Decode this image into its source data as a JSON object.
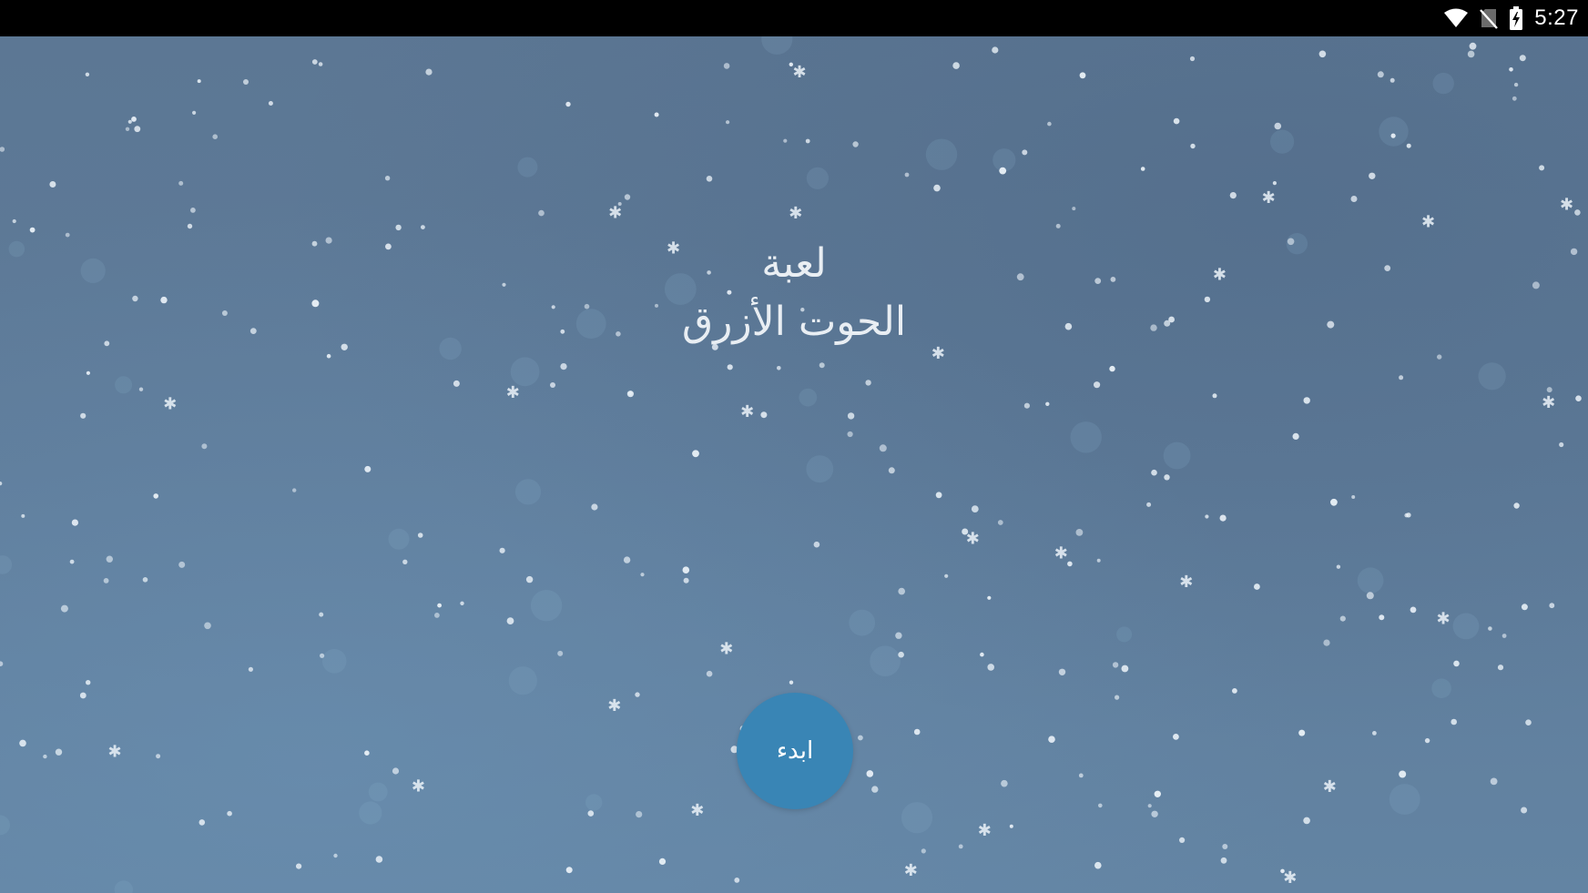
{
  "status_bar": {
    "time": "5:27",
    "icons": [
      "wifi-icon",
      "no-sim-icon",
      "battery-charging-icon"
    ]
  },
  "main": {
    "title_line1": "لعبة",
    "title_line2": "الحوت الأزرق",
    "start_label": "ابدء"
  },
  "colors": {
    "background": "#5e7b99",
    "button": "#3985b5",
    "status_bar": "#000000",
    "text": "#e9eef3"
  }
}
